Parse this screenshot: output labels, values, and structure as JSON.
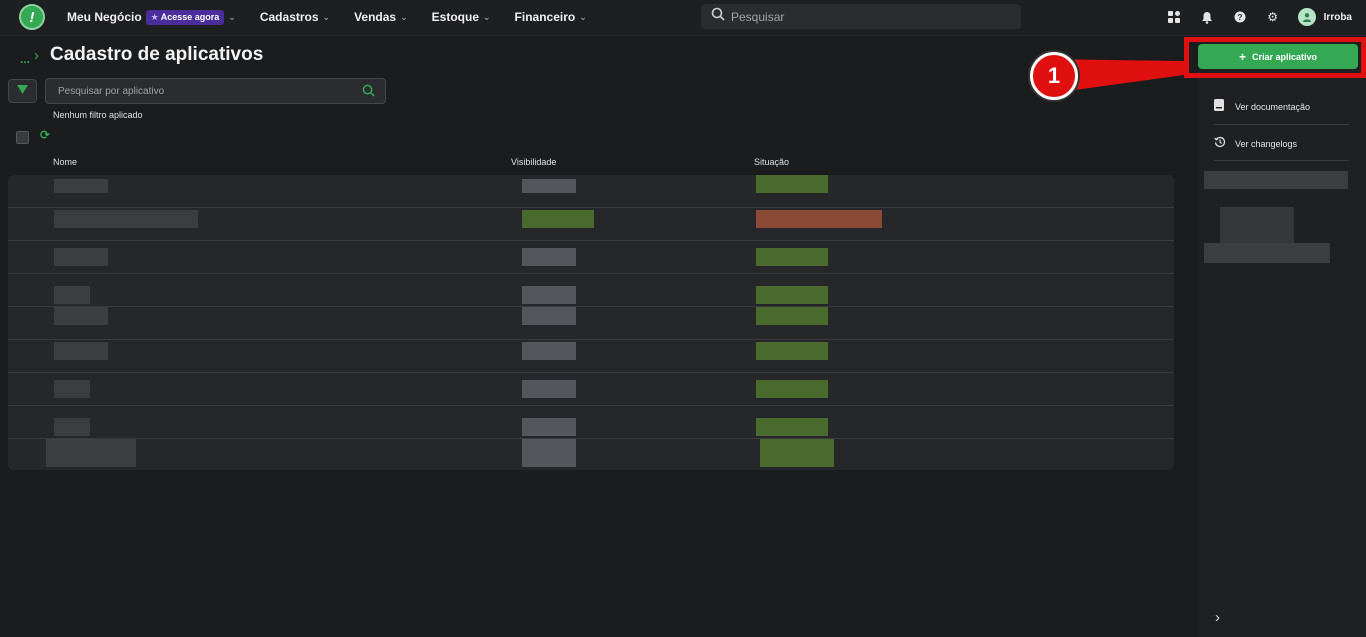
{
  "topbar": {
    "logo_glyph": "!",
    "business": "Meu Negócio",
    "badge": "Acesse agora",
    "nav": [
      "Cadastros",
      "Vendas",
      "Estoque",
      "Financeiro"
    ],
    "search_placeholder": "Pesquisar",
    "user_name": "Irroba"
  },
  "breadcrumb": {
    "ellipsis": "...",
    "separator": "›"
  },
  "page_title": "Cadastro de aplicativos",
  "filter": {
    "search_placeholder": "Pesquisar por aplicativo",
    "status": "Nenhum filtro aplicado"
  },
  "table": {
    "columns": {
      "name": "Nome",
      "visibility": "Visibilidade",
      "status": "Situação"
    },
    "row_count": 9
  },
  "right_panel": {
    "create_button": "Criar aplicativo",
    "links": [
      "Ver documentação",
      "Ver changelogs"
    ]
  },
  "annotation": {
    "step": "1"
  },
  "colors": {
    "accent": "#34a853",
    "highlight": "#e01010",
    "badge": "#4b2e9c"
  }
}
